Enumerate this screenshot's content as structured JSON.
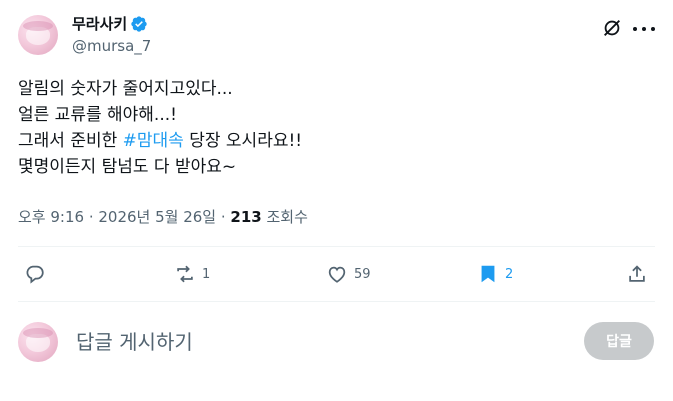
{
  "author": {
    "display_name": "무라사키",
    "handle": "@mursa_7",
    "verified": true
  },
  "post": {
    "lines": [
      {
        "text": "알림의 숫자가 줄어지고있다..."
      },
      {
        "text": "얼른 교류를 해야해...!"
      },
      {
        "before": "그래서 준비한 ",
        "hashtag": "#맘대속",
        "after": " 당장 오시라요!!"
      },
      {
        "text": "몇명이든지 탐넘도 다 받아요~"
      }
    ],
    "timestamp": "오후 9:16 · 2026년 5월 26일",
    "separator": " · ",
    "views_count": "213",
    "views_label": " 조회수"
  },
  "actions": {
    "reply_count": "",
    "repost_count": "1",
    "like_count": "59",
    "bookmark_count": "2"
  },
  "reply_box": {
    "placeholder": "답글 게시하기",
    "button_label": "답글"
  },
  "icons": {
    "verified": "verified-badge-icon",
    "grok": "grok-icon",
    "more": "more-icon",
    "reply": "reply-icon",
    "repost": "repost-icon",
    "like": "heart-icon",
    "bookmark": "bookmark-icon",
    "share": "share-icon"
  },
  "colors": {
    "accent": "#1d9bf0",
    "secondary_text": "#536471",
    "primary_text": "#0f1419",
    "disabled_button": "#c7cacc"
  }
}
